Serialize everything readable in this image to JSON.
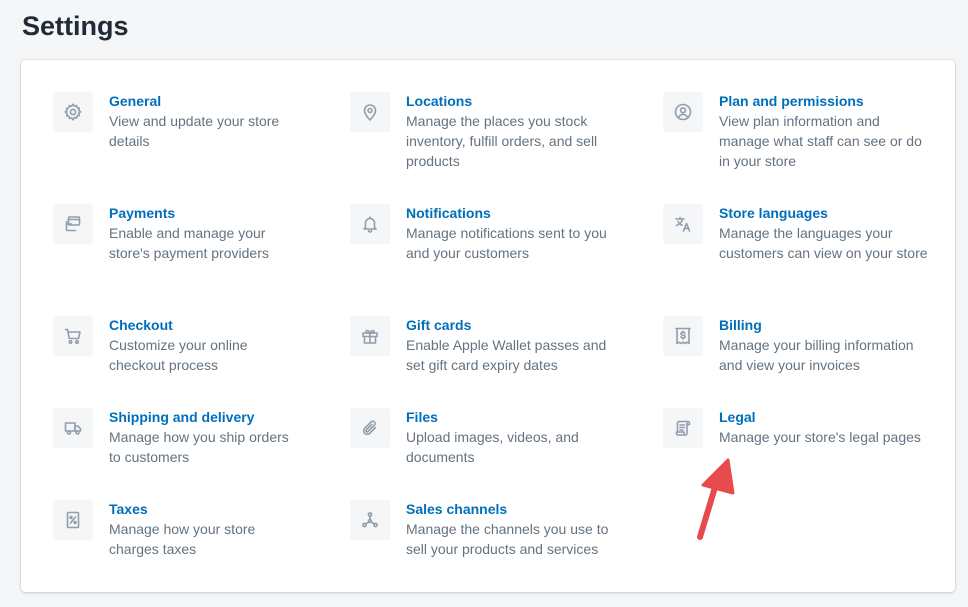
{
  "page": {
    "title": "Settings"
  },
  "colors": {
    "link": "#006fbb",
    "muted": "#637381",
    "icon": "#919eab",
    "arrow": "#e84b4b"
  },
  "settings": [
    {
      "title": "General",
      "desc": "View and update your store details",
      "icon": "gear-icon"
    },
    {
      "title": "Locations",
      "desc": "Manage the places you stock inventory, fulfill orders, and sell products",
      "icon": "location-pin-icon"
    },
    {
      "title": "Plan and permissions",
      "desc": "View plan information and manage what staff can see or do in your store",
      "icon": "user-circle-icon"
    },
    {
      "title": "Payments",
      "desc": "Enable and manage your store's payment providers",
      "icon": "payment-card-icon"
    },
    {
      "title": "Notifications",
      "desc": "Manage notifications sent to you and your customers",
      "icon": "bell-icon"
    },
    {
      "title": "Store languages",
      "desc": "Manage the languages your customers can view on your store",
      "icon": "translate-icon"
    },
    {
      "title": "Checkout",
      "desc": "Customize your online checkout process",
      "icon": "cart-icon"
    },
    {
      "title": "Gift cards",
      "desc": "Enable Apple Wallet passes and set gift card expiry dates",
      "icon": "gift-icon"
    },
    {
      "title": "Billing",
      "desc": "Manage your billing information and view your invoices",
      "icon": "receipt-dollar-icon"
    },
    {
      "title": "Shipping and delivery",
      "desc": "Manage how you ship orders to customers",
      "icon": "truck-icon"
    },
    {
      "title": "Files",
      "desc": "Upload images, videos, and documents",
      "icon": "paperclip-icon"
    },
    {
      "title": "Legal",
      "desc": "Manage your store's legal pages",
      "icon": "legal-document-icon"
    },
    {
      "title": "Taxes",
      "desc": "Manage how your store charges taxes",
      "icon": "tax-receipt-icon"
    },
    {
      "title": "Sales channels",
      "desc": "Manage the channels you use to sell your products and services",
      "icon": "channels-icon"
    }
  ]
}
